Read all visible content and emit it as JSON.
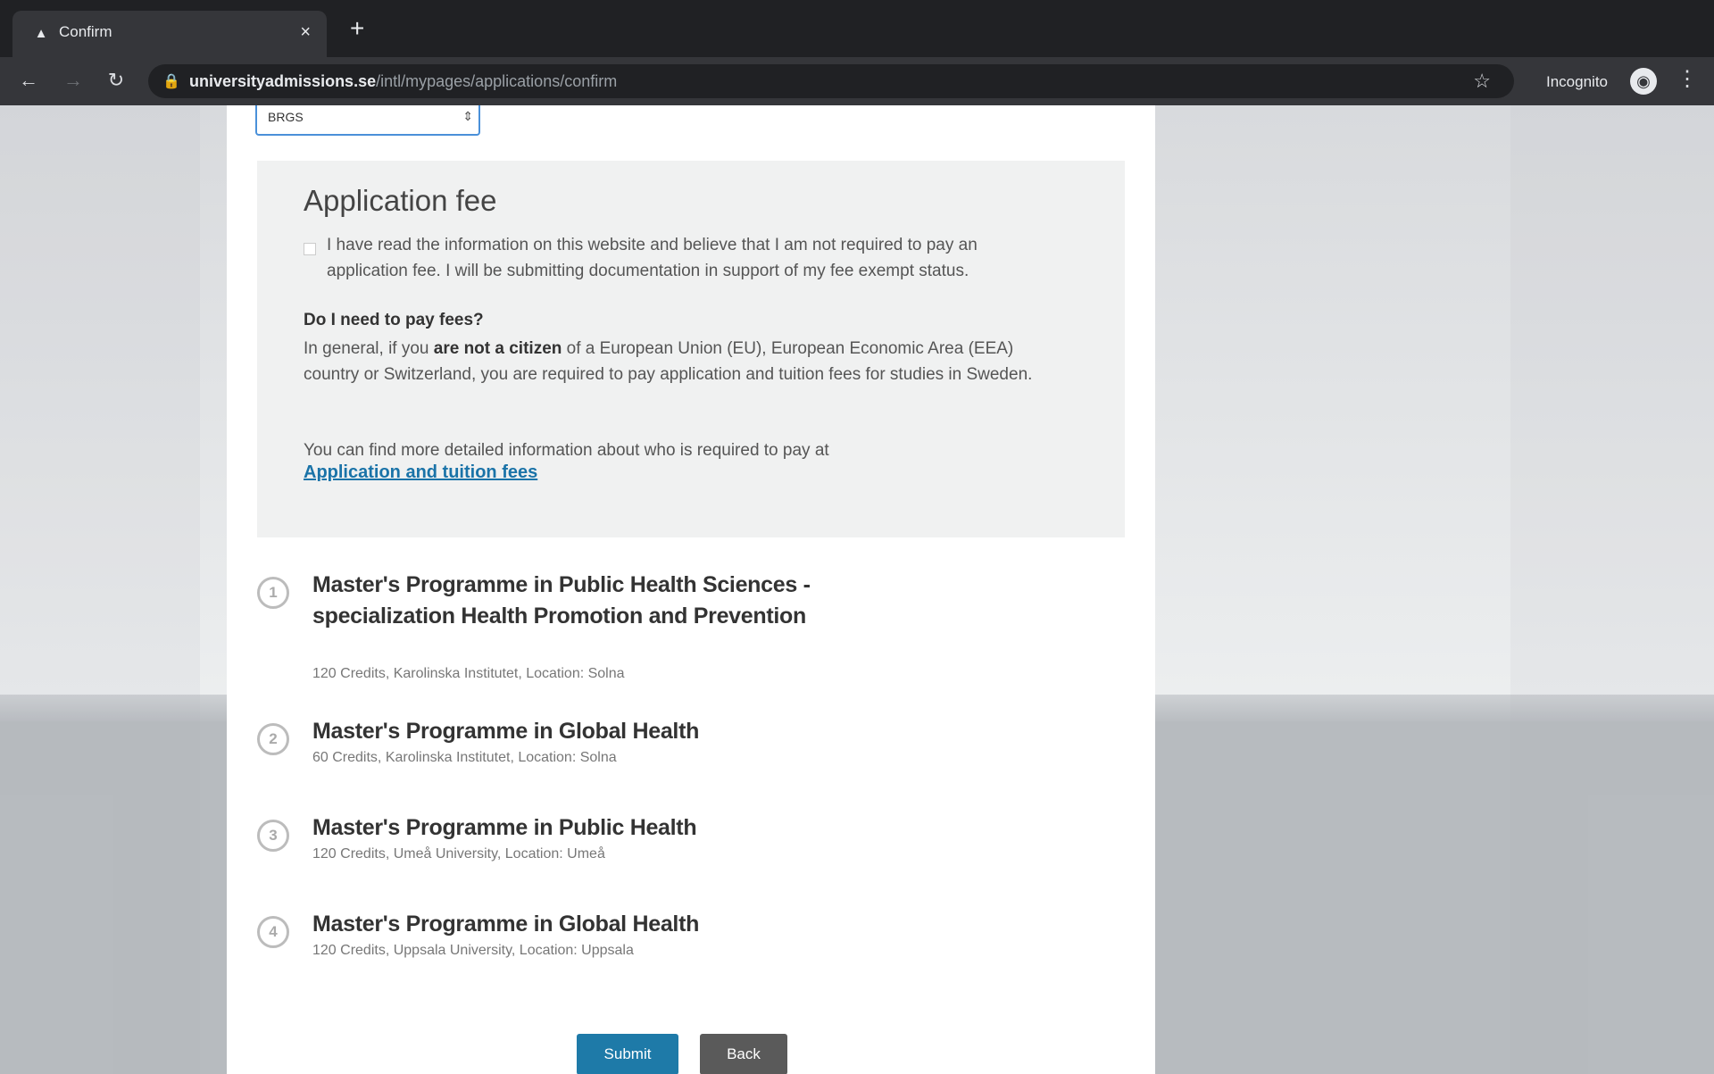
{
  "browser": {
    "tab_title": "Confirm",
    "tab_close": "×",
    "new_tab": "+",
    "url_host": "universityadmissions.se",
    "url_path": "/intl/mypages/applications/confirm",
    "incognito_label": "Incognito",
    "icons": [
      "back-arrow-icon",
      "forward-arrow-icon",
      "reload-icon",
      "lock-icon",
      "star-icon",
      "incognito-icon",
      "menu-dots-icon"
    ]
  },
  "form": {
    "select_value": "BRGS"
  },
  "fee": {
    "title": "Application fee",
    "checkbox_text": "I have read the information on this website and believe that I am not required to pay an application fee. I will be submitting documentation in support of my fee exempt status.",
    "question": "Do I need to pay fees?",
    "general_prefix": "In general, if you ",
    "general_bold": "are not a citizen",
    "general_suffix": " of a European Union (EU), European Economic Area (EEA) country or Switzerland, you are required to pay application and tuition fees for studies in Sweden.",
    "more_info": "You can find more detailed information about who is required to pay at",
    "link_text": "Application and tuition fees"
  },
  "programmes": [
    {
      "num": "1",
      "title": "Master's Programme in Public Health Sciences - specialization Health Promotion and Prevention",
      "meta": "120 Credits, Karolinska Institutet, Location: Solna"
    },
    {
      "num": "2",
      "title": "Master's Programme in Global Health",
      "meta": "60 Credits, Karolinska Institutet, Location: Solna"
    },
    {
      "num": "3",
      "title": "Master's Programme in Public Health",
      "meta": "120 Credits, Umeå University, Location: Umeå"
    },
    {
      "num": "4",
      "title": "Master's Programme in Global Health",
      "meta": "120 Credits, Uppsala University, Location: Uppsala"
    }
  ],
  "buttons": {
    "submit": "Submit",
    "back": "Back"
  },
  "colors": {
    "submit": "#1e7aa8",
    "back": "#5a5a5a",
    "link": "#1a73a8"
  }
}
